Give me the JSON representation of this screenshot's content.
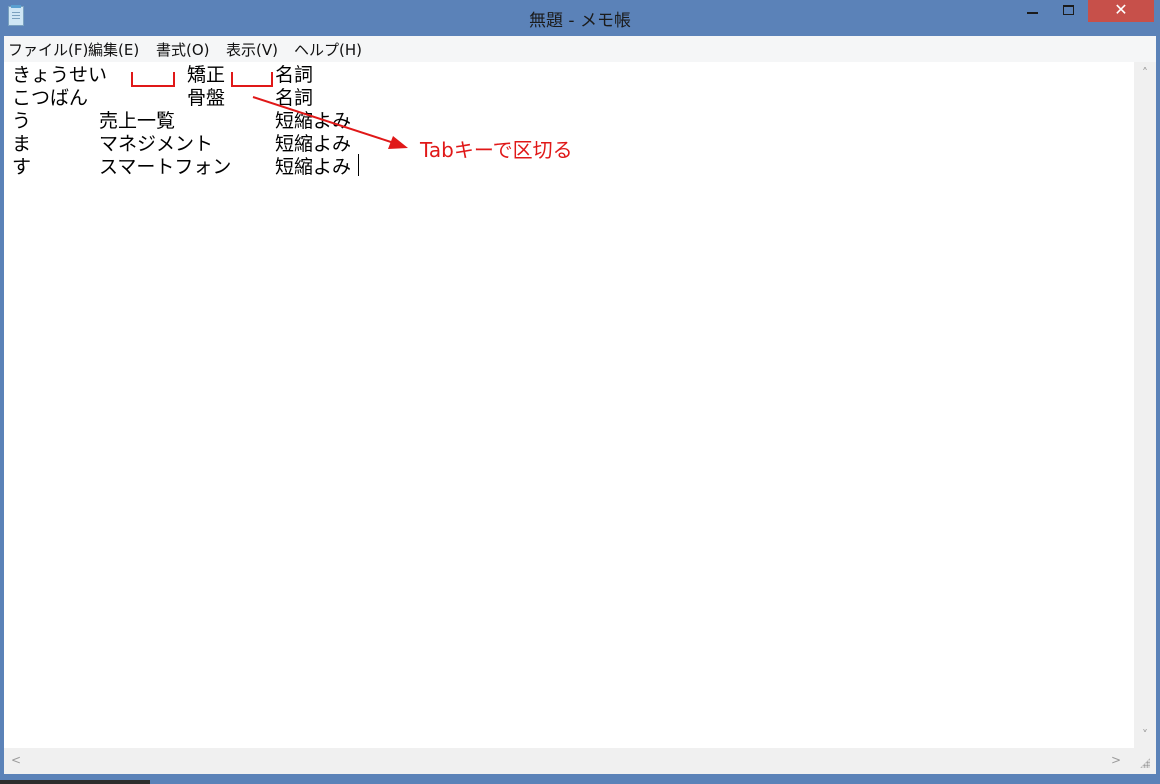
{
  "window": {
    "title": "無題 - メモ帳",
    "icon": "notepad-icon",
    "controls": {
      "minimize_icon": "minimize-icon",
      "maximize_icon": "maximize-icon",
      "close_label": "✕"
    }
  },
  "menubar": {
    "items": [
      {
        "label": "ファイル(F)"
      },
      {
        "label": "編集(E)"
      },
      {
        "label": "書式(O)"
      },
      {
        "label": "表示(V)"
      },
      {
        "label": "ヘルプ(H)"
      }
    ]
  },
  "document": {
    "lines": [
      {
        "c1": "きょうせい",
        "c2": "",
        "c3": "矯正",
        "c4": "名詞"
      },
      {
        "c1": "こつばん",
        "c2": "",
        "c3": "骨盤",
        "c4": "名詞"
      },
      {
        "c1": "う",
        "c2": "売上一覧",
        "c3": "",
        "c4": "短縮よみ"
      },
      {
        "c1": "ま",
        "c2": "マネジメント",
        "c3": "",
        "c4": "短縮よみ"
      },
      {
        "c1": "す",
        "c2": "スマートフォン",
        "c3": "",
        "c4": "短縮よみ"
      }
    ]
  },
  "annotation": {
    "label": "Tabキーで区切る",
    "color": "#e01818"
  },
  "scrollbars": {
    "up_arrow": "˄",
    "down_arrow": "˅",
    "left_arrow": "<",
    "right_arrow": ">"
  },
  "colors": {
    "titlebar": "#5b82b8",
    "close_button": "#c7504a",
    "menubar": "#f5f6f7",
    "editor_bg": "#ffffff"
  }
}
